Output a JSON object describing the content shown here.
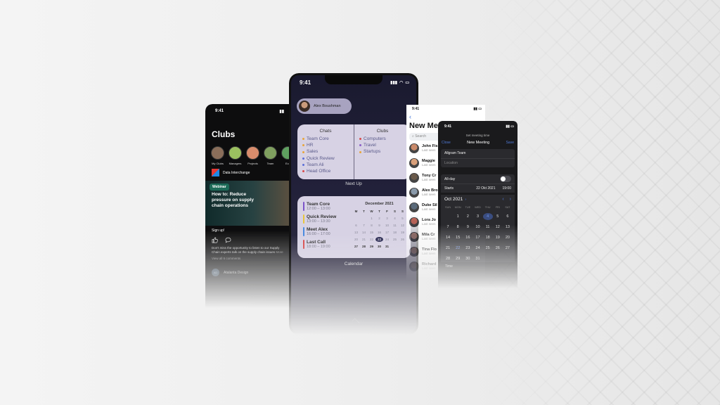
{
  "colors": {
    "widget_bg": "#d7d2e4",
    "accent_blue": "#4f79d8",
    "dot_orange": "#e8a43a",
    "dot_blue": "#5a6ed8",
    "dot_red": "#d84a4a",
    "dot_purple": "#8b5fc8",
    "bar_purple": "#7b54c8",
    "bar_yellow": "#e8c63a",
    "bar_blue": "#4a8be0",
    "bar_red": "#d84a4a"
  },
  "phone_clubs": {
    "status_time": "9:41",
    "title": "Clubs",
    "clubs": [
      {
        "label": "My Clubs",
        "color": "#8a6e5a"
      },
      {
        "label": "Managers",
        "color": "#9bc060"
      },
      {
        "label": "Projects",
        "color": "#d88c6c"
      },
      {
        "label": "Team",
        "color": "#7f9f5f"
      },
      {
        "label": "Eco",
        "color": "#5fa060"
      }
    ],
    "feed_source": "Data Interchange",
    "badge": "Webinar",
    "headline": "How to: Reduce pressure on supply chain operations",
    "cta": "Sign up!",
    "post_text": "Don't miss the opportunity to listen to our Supply Chain experts talk on the supply chain issues",
    "post_more": "More",
    "view_all": "View all 6 comments",
    "footer_initials": "AD",
    "footer_author": "Atalanta Design"
  },
  "phone_widgets": {
    "status_time": "9:41",
    "user_name": "Alex Boushman",
    "chats_title": "Chats",
    "chats": [
      "Team Core",
      "HR",
      "Sales",
      "Quick Review",
      "Team Ali",
      "Head Office"
    ],
    "clubs_title": "Clubs",
    "clubs": [
      "Computers",
      "Travel",
      "Startups"
    ],
    "next_up_label": "Next Up",
    "events": [
      {
        "name": "Team Core",
        "time": "12:00 – 13:00"
      },
      {
        "name": "Quick Review",
        "time": "13:00 – 13:30"
      },
      {
        "name": "Meet Alex",
        "time": "16:00 – 17:00"
      },
      {
        "name": "Last Call",
        "time": "18:00 – 19:00"
      }
    ],
    "calendar_month": "December 2021",
    "weekdays": [
      "M",
      "T",
      "W",
      "T",
      "F",
      "S",
      "S"
    ],
    "days": [
      "",
      "",
      "1",
      "2",
      "3",
      "4",
      "5",
      "6",
      "7",
      "8",
      "9",
      "10",
      "11",
      "12",
      "13",
      "14",
      "15",
      "16",
      "17",
      "18",
      "19",
      "20",
      "21",
      "22",
      "23",
      "24",
      "25",
      "26",
      "27",
      "28",
      "29",
      "30",
      "31",
      "",
      ""
    ],
    "today": "23",
    "calendar_label": "Calendar"
  },
  "phone_contacts": {
    "status_time": "9:41",
    "back_glyph": "‹",
    "title": "New Meeting",
    "search_placeholder": "Search",
    "contacts": [
      {
        "name": "John Fis",
        "sub": "Last seen",
        "color": "#c98a6a"
      },
      {
        "name": "Maggie",
        "sub": "Last seen",
        "color": "#d9a07a"
      },
      {
        "name": "Tony Cr",
        "sub": "Last seen",
        "color": "#6a5a4a"
      },
      {
        "name": "Alex Bro",
        "sub": "Last seen",
        "color": "#8a9aaa"
      },
      {
        "name": "Duke Sil",
        "sub": "Last seen",
        "color": "#5a6a7a"
      },
      {
        "name": "Lora Jo",
        "sub": "Last seen",
        "color": "#c96a5a"
      },
      {
        "name": "Mila Cr",
        "sub": "Last seen",
        "color": "#b88a7a"
      },
      {
        "name": "Tina Flo",
        "sub": "Last seen",
        "color": "#9a7a6a"
      },
      {
        "name": "Richard",
        "sub": "Last seen",
        "color": "#7a6a5a"
      }
    ]
  },
  "phone_meeting": {
    "status_time": "9:41",
    "hint": "Set meeting time",
    "close_label": "Close",
    "title": "New Meeting",
    "save_label": "Save",
    "team_value": "Allgram Team",
    "location_placeholder": "Location",
    "allday_label": "All-day",
    "starts_label": "Starts",
    "starts_date": "22 Okt 2021",
    "starts_time": "19:00",
    "month": "Oct 2021",
    "month_chevron": "›",
    "prev_glyph": "‹",
    "next_glyph": "›",
    "weekdays": [
      "SUN",
      "MON",
      "TUE",
      "WED",
      "THU",
      "FRI",
      "SAT"
    ],
    "days": [
      "",
      "1",
      "2",
      "3",
      "4",
      "5",
      "6",
      "7",
      "8",
      "9",
      "10",
      "11",
      "12",
      "13",
      "14",
      "15",
      "16",
      "17",
      "18",
      "19",
      "20",
      "21",
      "22",
      "23",
      "24",
      "25",
      "26",
      "27",
      "28",
      "29",
      "30",
      "31",
      "",
      "",
      ""
    ],
    "selected_day": "4",
    "highlight_day": "22",
    "time_label": "Time"
  }
}
